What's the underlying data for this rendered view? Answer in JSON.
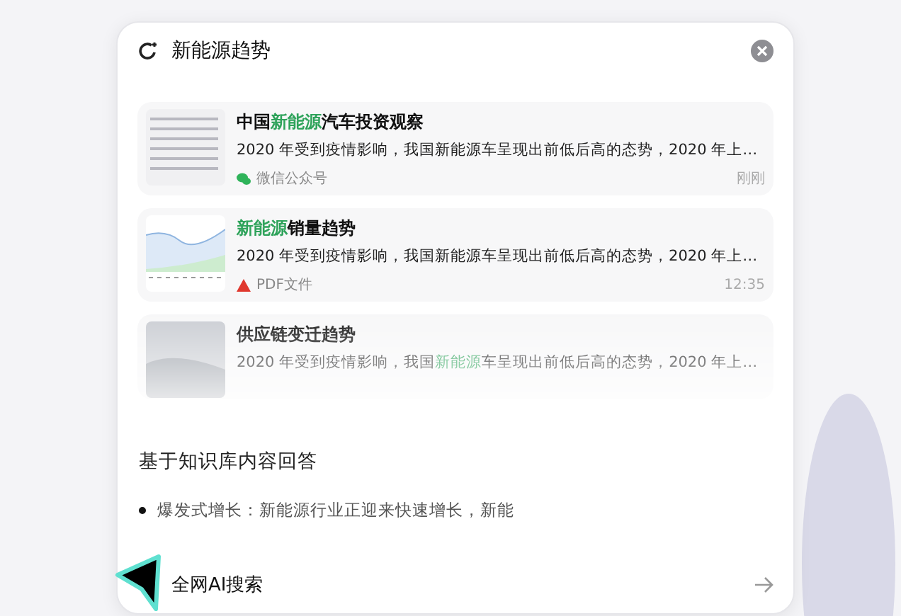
{
  "search": {
    "value": "新能源趋势"
  },
  "results": [
    {
      "thumbnail": {
        "kind": "document"
      },
      "title": [
        {
          "text": "中国",
          "highlight": false
        },
        {
          "text": "新能源",
          "highlight": true
        },
        {
          "text": "汽车投资观察",
          "highlight": false
        }
      ],
      "snippet": [
        {
          "text": "2020 年受到疫情影响，我国新能源车呈现出前低后高的态势，2020 年上…",
          "highlight": false
        }
      ],
      "source": {
        "kind": "wechat",
        "label": "微信公众号"
      },
      "time": "刚刚"
    },
    {
      "thumbnail": {
        "kind": "chart"
      },
      "title": [
        {
          "text": "新能源",
          "highlight": true
        },
        {
          "text": "销量趋势",
          "highlight": false
        }
      ],
      "snippet": [
        {
          "text": "2020 年受到疫情影响，我国新能源车呈现出前低后高的态势，2020 年上…",
          "highlight": false
        }
      ],
      "source": {
        "kind": "pdf",
        "label": "PDF文件"
      },
      "time": "12:35"
    },
    {
      "thumbnail": {
        "kind": "photo"
      },
      "title": [
        {
          "text": "供应链变迁趋势",
          "highlight": false
        }
      ],
      "snippet": [
        {
          "text": "2020 年受到疫情影响，我国",
          "highlight": false
        },
        {
          "text": "新能源",
          "highlight": true
        },
        {
          "text": "车呈现出前低后高的态势，2020 年上…",
          "highlight": false
        }
      ]
    }
  ],
  "answer": {
    "heading": "基于知识库内容回答",
    "bullets": [
      "爆发式增长：新能源行业正迎来快速增长，新能"
    ]
  },
  "footer": {
    "label": "全网AI搜索"
  }
}
